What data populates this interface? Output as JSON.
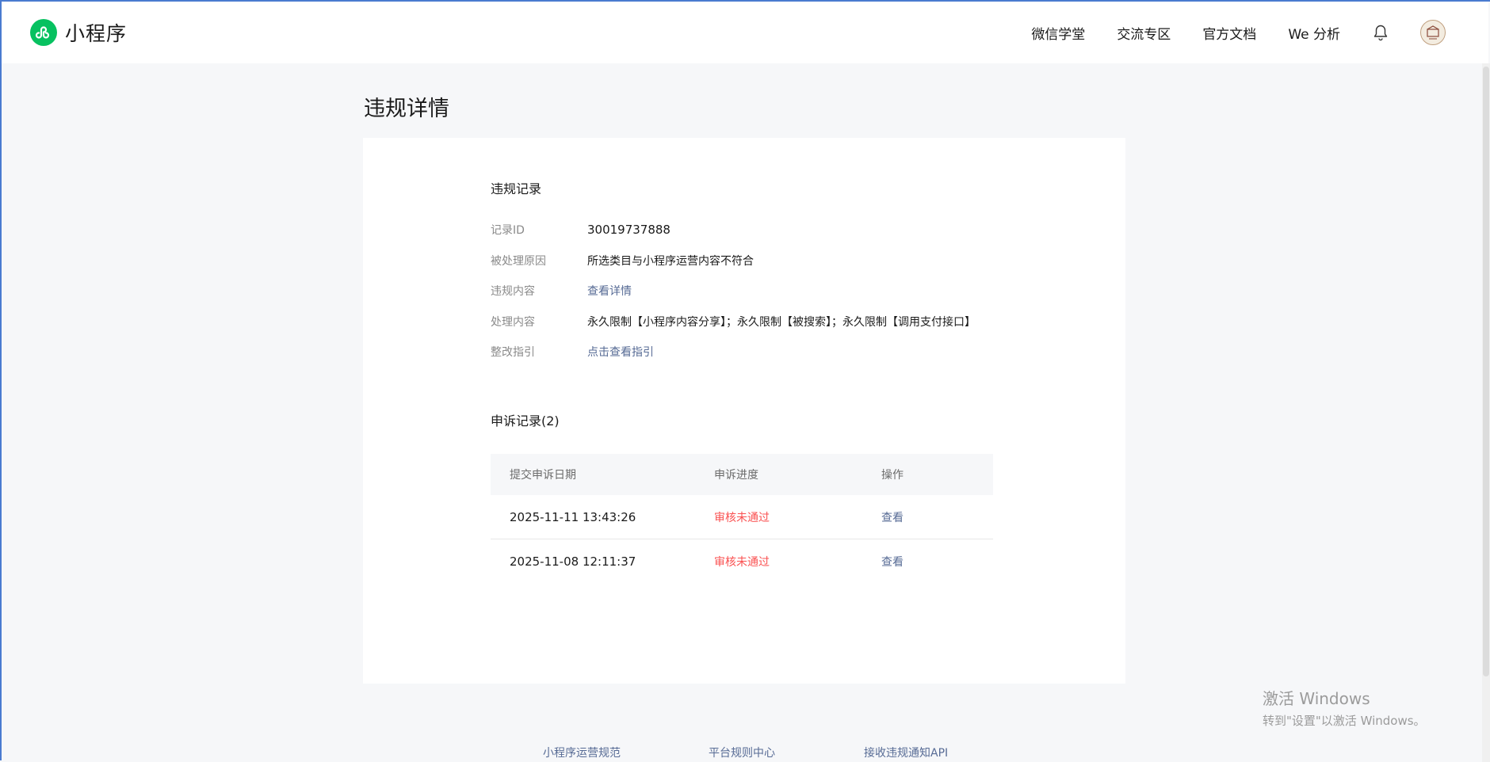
{
  "header": {
    "logo_text": "小程序",
    "nav": [
      "微信学堂",
      "交流专区",
      "官方文档",
      "We 分析"
    ]
  },
  "page": {
    "title": "违规详情"
  },
  "violation": {
    "section_title": "违规记录",
    "rows": [
      {
        "label": "记录ID",
        "value": "30019737888"
      },
      {
        "label": "被处理原因",
        "value": "所选类目与小程序运营内容不符合"
      },
      {
        "label": "违规内容",
        "value": "查看详情"
      },
      {
        "label": "处理内容",
        "value": "永久限制【小程序内容分享】；永久限制【被搜索】；永久限制【调用支付接口】"
      },
      {
        "label": "整改指引",
        "value": "点击查看指引"
      }
    ]
  },
  "appeals": {
    "section_title": "申诉记录(2)",
    "columns": [
      "提交申诉日期",
      "申诉进度",
      "操作"
    ],
    "rows": [
      {
        "date": "2025-11-11 13:43:26",
        "status": "审核未通过",
        "action": "查看"
      },
      {
        "date": "2025-11-08 12:11:37",
        "status": "审核未通过",
        "action": "查看"
      }
    ]
  },
  "footer": {
    "links": [
      "小程序运营规范",
      "平台规则中心",
      "接收违规通知API"
    ]
  },
  "watermark": {
    "line1": "激活 Windows",
    "line2": "转到\"设置\"以激活 Windows。"
  },
  "colors": {
    "brand_green": "#07c160",
    "link_blue": "#576b95",
    "fail_red": "#fa5151"
  }
}
